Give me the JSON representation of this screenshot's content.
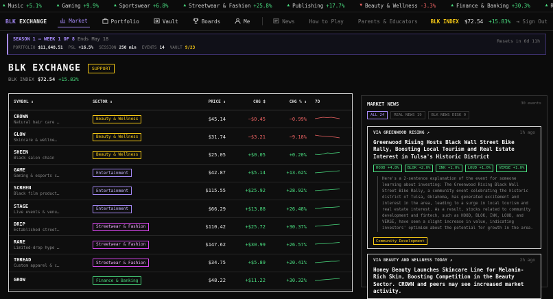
{
  "ticker": [
    {
      "name": "Music",
      "change": "+5.1%",
      "dir": "up"
    },
    {
      "name": "Gaming",
      "change": "+9.9%",
      "dir": "up"
    },
    {
      "name": "Sportswear",
      "change": "+6.8%",
      "dir": "up"
    },
    {
      "name": "Streetwear & Fashion",
      "change": "+25.8%",
      "dir": "up"
    },
    {
      "name": "Publishing",
      "change": "+17.7%",
      "dir": "up"
    },
    {
      "name": "Beauty & Wellness",
      "change": "-3.3%",
      "dir": "down"
    },
    {
      "name": "Finance & Banking",
      "change": "+30.3%",
      "dir": "up"
    },
    {
      "name": "Real Estate",
      "change": "+",
      "dir": "up"
    }
  ],
  "nav": {
    "logo_a": "BLK",
    "logo_b": "EXCHANGE",
    "items": [
      {
        "label": "Market",
        "icon": "chart-icon"
      },
      {
        "label": "Portfolio",
        "icon": "briefcase-icon"
      },
      {
        "label": "Vault",
        "icon": "vault-icon"
      },
      {
        "label": "Boards",
        "icon": "trophy-icon"
      },
      {
        "label": "Me",
        "icon": "user-icon"
      }
    ],
    "secondary": [
      {
        "label": "News",
        "icon": "news-icon"
      },
      {
        "label": "How to Play"
      },
      {
        "label": "Parents & Educators"
      }
    ],
    "index_label": "BLK INDEX",
    "index_value": "$72.54",
    "index_change": "+15.83%",
    "signout": "Sign Out"
  },
  "season": {
    "title": "SEASON 1 — WEEK 1 OF 8",
    "ends": "Ends May 18",
    "reset": "Resets in 6d 11h",
    "portfolio_label": "PORTFOLIO",
    "portfolio_value": "$11,648.51",
    "pnl_label": "P&L",
    "pnl_value": "+16.5%",
    "session_label": "SESSION",
    "session_value": "250 min",
    "events_label": "EVENTS",
    "events_value": "14",
    "vault_label": "VAULT",
    "vault_value": "9/23"
  },
  "exchange": {
    "title": "BLK EXCHANGE",
    "support": "SUPPORT",
    "index_label": "BLK INDEX",
    "index_value": "$72.54",
    "index_change": "+15.83%"
  },
  "table": {
    "headers": {
      "symbol": "SYMBOL ↕",
      "sector": "SECTOR ↕",
      "price": "PRICE ↕",
      "chg": "CHG $",
      "pct": "CHG % ↕",
      "d7": "7D"
    },
    "rows": [
      {
        "sym": "CROWN",
        "name": "Natural hair care …",
        "sector": "Beauty & Wellness",
        "cls": "sec-beauty",
        "price": "$45.14",
        "chg": "−$0.45",
        "pct": "−0.99%",
        "dir": "down",
        "spark": [
          5,
          4,
          3,
          3.5,
          3,
          4,
          5
        ]
      },
      {
        "sym": "GLOW",
        "name": "Skincare & wellne…",
        "sector": "Beauty & Wellness",
        "cls": "sec-beauty",
        "price": "$31.74",
        "chg": "−$3.21",
        "pct": "−9.18%",
        "dir": "down",
        "spark": [
          3,
          4,
          4.5,
          5,
          5.5,
          6,
          7
        ]
      },
      {
        "sym": "SHEEN",
        "name": "Black salon chain",
        "sector": "Beauty & Wellness",
        "cls": "sec-beauty",
        "price": "$25.05",
        "chg": "+$0.05",
        "pct": "+0.20%",
        "dir": "up",
        "spark": [
          5,
          5.5,
          4.5,
          3,
          3.5,
          3,
          2.5
        ]
      },
      {
        "sym": "GAME",
        "name": "Gaming & esports c…",
        "sector": "Entertainment",
        "cls": "sec-ent",
        "price": "$42.87",
        "chg": "+$5.14",
        "pct": "+13.62%",
        "dir": "up",
        "spark": [
          5,
          4.5,
          4,
          3.5,
          3,
          2.5,
          2
        ]
      },
      {
        "sym": "SCREEN",
        "name": "Black film product…",
        "sector": "Entertainment",
        "cls": "sec-ent",
        "price": "$115.55",
        "chg": "+$25.92",
        "pct": "+28.92%",
        "dir": "up",
        "spark": [
          5,
          4.5,
          4,
          4,
          3.5,
          3,
          2.5
        ]
      },
      {
        "sym": "STAGE",
        "name": "Live events & venu…",
        "sector": "Entertainment",
        "cls": "sec-ent",
        "price": "$66.29",
        "chg": "+$13.88",
        "pct": "+26.48%",
        "dir": "up",
        "spark": [
          5,
          4.5,
          4,
          3.5,
          3.5,
          3,
          2.5
        ]
      },
      {
        "sym": "DRIP",
        "name": "Established street…",
        "sector": "Streetwear & Fashion",
        "cls": "sec-street",
        "price": "$110.42",
        "chg": "+$25.72",
        "pct": "+30.37%",
        "dir": "up",
        "spark": [
          5,
          4.5,
          4,
          3.5,
          3,
          2.5,
          2
        ]
      },
      {
        "sym": "RARE",
        "name": "Limited-drop hype …",
        "sector": "Streetwear & Fashion",
        "cls": "sec-street",
        "price": "$147.62",
        "chg": "+$30.99",
        "pct": "+26.57%",
        "dir": "up",
        "spark": [
          5,
          4.5,
          4.5,
          4,
          3.5,
          3,
          2.5
        ]
      },
      {
        "sym": "THREAD",
        "name": "Custom apparel & c…",
        "sector": "Streetwear & Fashion",
        "cls": "sec-street",
        "price": "$34.75",
        "chg": "+$5.89",
        "pct": "+20.41%",
        "dir": "up",
        "spark": [
          5,
          4.5,
          4,
          3.5,
          3,
          3,
          2.5
        ]
      },
      {
        "sym": "GROW",
        "name": "",
        "sector": "Finance & Banking",
        "cls": "sec-fin",
        "price": "$48.22",
        "chg": "+$11.22",
        "pct": "+30.32%",
        "dir": "up",
        "spark": [
          5,
          4.5,
          4,
          3.5,
          3,
          2.5,
          2
        ]
      }
    ]
  },
  "news": {
    "title": "MARKET NEWS",
    "count": "30 events",
    "tabs": [
      "ALL 24",
      "REAL NEWS 19",
      "BLK NEWS DESK 0"
    ],
    "cards": [
      {
        "source": "VIA GREENWOOD RISING ↗",
        "ago": "1h ago",
        "title": "Greenwood Rising Hosts Black Wall Street Bike Rally, Boosting Local Tourism and Real Estate Interest in Tulsa's Historic District",
        "chips": [
          "HOOD +4.8%",
          "BLOK +2.0%",
          "INK +1.0%",
          "LOUD +1.0%",
          "VERSE +1.0%"
        ],
        "body": "Here's a 2-sentence explanation of the event for someone learning about investing: The Greenwood Rising Black Wall Street Bike Rally, a community event celebrating the historic district of Tulsa, Oklahoma, has generated excitement and interest in the area, leading to a surge in local tourism and real estate interest. As a result, stocks related to community development and fintech, such as HOOD, BLOK, INK, LOUD, and VERSE, have seen a slight increase in value, indicating investors' optimism about the potential for growth in the area.",
        "tag": "Community Development"
      },
      {
        "source": "VIA BEAUTY AND WELLNESS TODAY ↗",
        "ago": "2h ago",
        "title": "Honey Beauty Launches Skincare Line for Melanin-Rich Skin, Boosting Competition in the Beauty Sector. CROWN and peers may see increased market activity."
      }
    ]
  },
  "colors": {
    "accent": "#a78bfa",
    "up": "#4ade80",
    "down": "#f06464",
    "gold": "#facc15"
  }
}
